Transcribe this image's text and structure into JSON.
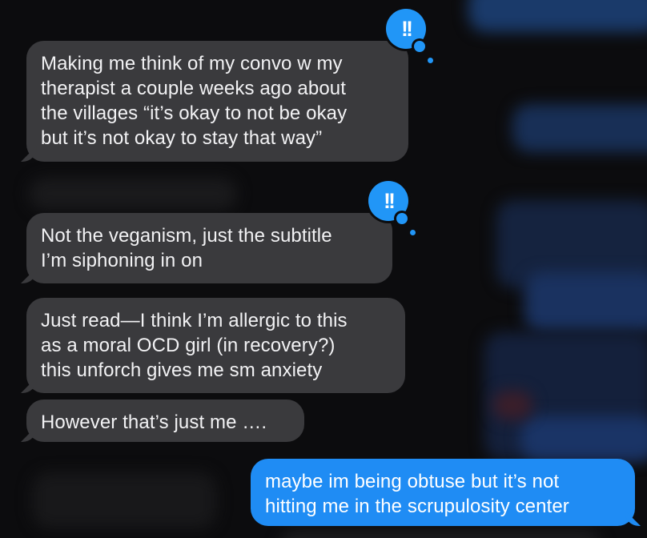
{
  "colors": {
    "background": "#0c0c0e",
    "received_bubble": "#3a3a3d",
    "sent_bubble": "#1f8cf4",
    "tapback": "#2196f7"
  },
  "messages": [
    {
      "direction": "received",
      "lines": [
        "Making me think of my convo w my",
        "therapist a couple weeks ago about",
        "the villages “it’s okay to not be okay",
        "but it’s not okay to stay that way”"
      ],
      "tapback": {
        "icon": "exclamation-tapback-icon",
        "glyph": "!!"
      }
    },
    {
      "direction": "received",
      "lines": [
        "Not the veganism, just the subtitle",
        "I’m siphoning in on"
      ],
      "tapback": {
        "icon": "exclamation-tapback-icon",
        "glyph": "!!"
      }
    },
    {
      "direction": "received",
      "lines": [
        "Just read—I think I’m allergic to this",
        "as a moral OCD girl (in recovery?)",
        "this unforch gives me sm anxiety"
      ]
    },
    {
      "direction": "received",
      "lines": [
        "However that’s just me …."
      ]
    },
    {
      "direction": "sent",
      "lines": [
        "maybe im being obtuse but it’s not",
        "hitting me in the scrupulosity center"
      ]
    }
  ]
}
